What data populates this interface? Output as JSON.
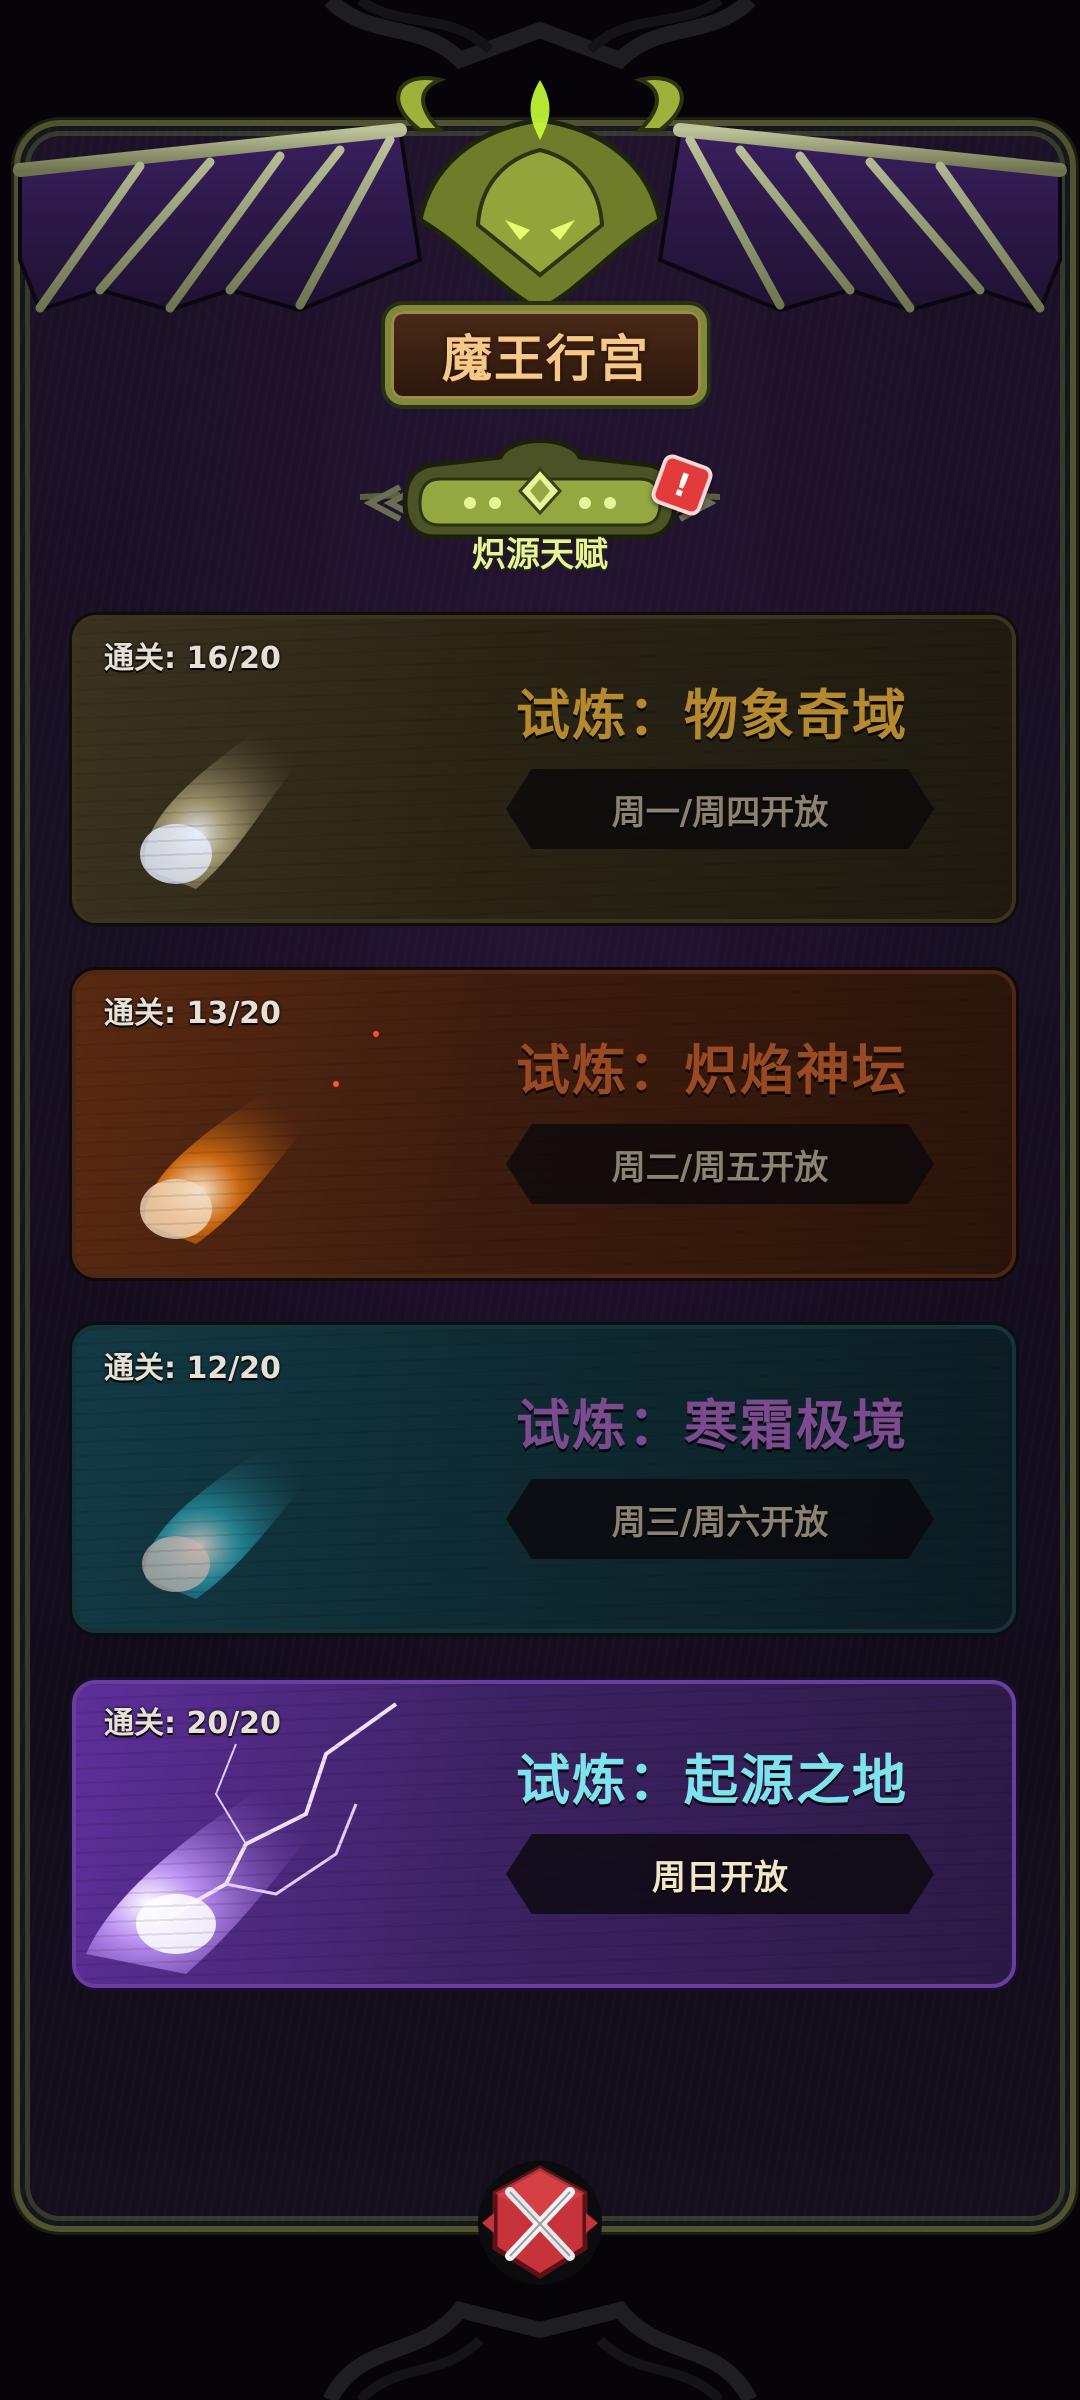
{
  "header": {
    "title": "魔王行宫"
  },
  "talent": {
    "label": "炽源天赋",
    "alert_symbol": "!"
  },
  "trials": [
    {
      "progress": "通关: 16/20",
      "name": "试炼：物象奇域",
      "schedule": "周一/周四开放",
      "theme": "gold",
      "comet_color": "#d9cfa2"
    },
    {
      "progress": "通关: 13/20",
      "name": "试炼：炽焰神坛",
      "schedule": "周二/周五开放",
      "theme": "fire",
      "comet_color": "#f08a1c"
    },
    {
      "progress": "通关: 12/20",
      "name": "试炼：寒霜极境",
      "schedule": "周三/周六开放",
      "theme": "frost",
      "comet_color": "#2fa6b8"
    },
    {
      "progress": "通关: 20/20",
      "name": "试炼：起源之地",
      "schedule": "周日开放",
      "theme": "origin",
      "comet_color": "#c07cff"
    }
  ],
  "colors": {
    "panel_border": "#50532f",
    "title_text": "#f6c98a",
    "talent_text": "#eaf39a",
    "alert": "#e33b3b",
    "close_button": "#c6333b"
  },
  "icons": {
    "close": "crossed-swords-close-icon",
    "alert": "exclamation-alert-icon",
    "emblem": "demon-skull-emblem-icon"
  }
}
